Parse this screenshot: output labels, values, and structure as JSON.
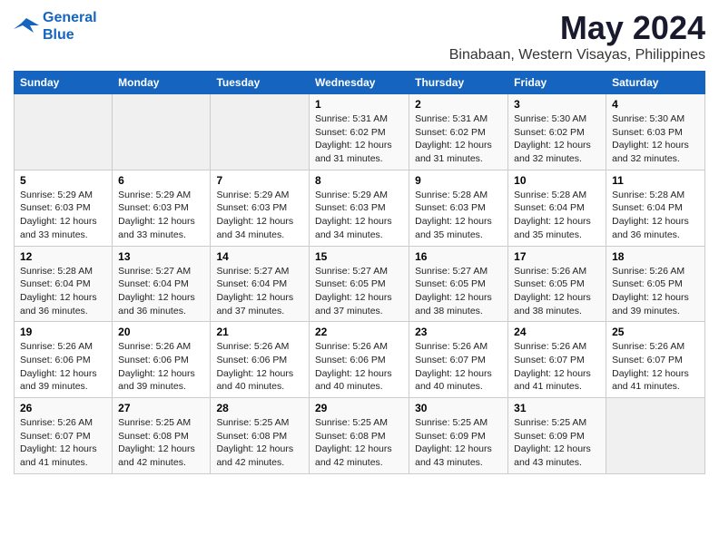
{
  "logo": {
    "line1": "General",
    "line2": "Blue"
  },
  "title": "May 2024",
  "subtitle": "Binabaan, Western Visayas, Philippines",
  "weekdays": [
    "Sunday",
    "Monday",
    "Tuesday",
    "Wednesday",
    "Thursday",
    "Friday",
    "Saturday"
  ],
  "weeks": [
    [
      {
        "day": "",
        "info": ""
      },
      {
        "day": "",
        "info": ""
      },
      {
        "day": "",
        "info": ""
      },
      {
        "day": "1",
        "info": "Sunrise: 5:31 AM\nSunset: 6:02 PM\nDaylight: 12 hours and 31 minutes."
      },
      {
        "day": "2",
        "info": "Sunrise: 5:31 AM\nSunset: 6:02 PM\nDaylight: 12 hours and 31 minutes."
      },
      {
        "day": "3",
        "info": "Sunrise: 5:30 AM\nSunset: 6:02 PM\nDaylight: 12 hours and 32 minutes."
      },
      {
        "day": "4",
        "info": "Sunrise: 5:30 AM\nSunset: 6:03 PM\nDaylight: 12 hours and 32 minutes."
      }
    ],
    [
      {
        "day": "5",
        "info": "Sunrise: 5:29 AM\nSunset: 6:03 PM\nDaylight: 12 hours and 33 minutes."
      },
      {
        "day": "6",
        "info": "Sunrise: 5:29 AM\nSunset: 6:03 PM\nDaylight: 12 hours and 33 minutes."
      },
      {
        "day": "7",
        "info": "Sunrise: 5:29 AM\nSunset: 6:03 PM\nDaylight: 12 hours and 34 minutes."
      },
      {
        "day": "8",
        "info": "Sunrise: 5:29 AM\nSunset: 6:03 PM\nDaylight: 12 hours and 34 minutes."
      },
      {
        "day": "9",
        "info": "Sunrise: 5:28 AM\nSunset: 6:03 PM\nDaylight: 12 hours and 35 minutes."
      },
      {
        "day": "10",
        "info": "Sunrise: 5:28 AM\nSunset: 6:04 PM\nDaylight: 12 hours and 35 minutes."
      },
      {
        "day": "11",
        "info": "Sunrise: 5:28 AM\nSunset: 6:04 PM\nDaylight: 12 hours and 36 minutes."
      }
    ],
    [
      {
        "day": "12",
        "info": "Sunrise: 5:28 AM\nSunset: 6:04 PM\nDaylight: 12 hours and 36 minutes."
      },
      {
        "day": "13",
        "info": "Sunrise: 5:27 AM\nSunset: 6:04 PM\nDaylight: 12 hours and 36 minutes."
      },
      {
        "day": "14",
        "info": "Sunrise: 5:27 AM\nSunset: 6:04 PM\nDaylight: 12 hours and 37 minutes."
      },
      {
        "day": "15",
        "info": "Sunrise: 5:27 AM\nSunset: 6:05 PM\nDaylight: 12 hours and 37 minutes."
      },
      {
        "day": "16",
        "info": "Sunrise: 5:27 AM\nSunset: 6:05 PM\nDaylight: 12 hours and 38 minutes."
      },
      {
        "day": "17",
        "info": "Sunrise: 5:26 AM\nSunset: 6:05 PM\nDaylight: 12 hours and 38 minutes."
      },
      {
        "day": "18",
        "info": "Sunrise: 5:26 AM\nSunset: 6:05 PM\nDaylight: 12 hours and 39 minutes."
      }
    ],
    [
      {
        "day": "19",
        "info": "Sunrise: 5:26 AM\nSunset: 6:06 PM\nDaylight: 12 hours and 39 minutes."
      },
      {
        "day": "20",
        "info": "Sunrise: 5:26 AM\nSunset: 6:06 PM\nDaylight: 12 hours and 39 minutes."
      },
      {
        "day": "21",
        "info": "Sunrise: 5:26 AM\nSunset: 6:06 PM\nDaylight: 12 hours and 40 minutes."
      },
      {
        "day": "22",
        "info": "Sunrise: 5:26 AM\nSunset: 6:06 PM\nDaylight: 12 hours and 40 minutes."
      },
      {
        "day": "23",
        "info": "Sunrise: 5:26 AM\nSunset: 6:07 PM\nDaylight: 12 hours and 40 minutes."
      },
      {
        "day": "24",
        "info": "Sunrise: 5:26 AM\nSunset: 6:07 PM\nDaylight: 12 hours and 41 minutes."
      },
      {
        "day": "25",
        "info": "Sunrise: 5:26 AM\nSunset: 6:07 PM\nDaylight: 12 hours and 41 minutes."
      }
    ],
    [
      {
        "day": "26",
        "info": "Sunrise: 5:26 AM\nSunset: 6:07 PM\nDaylight: 12 hours and 41 minutes."
      },
      {
        "day": "27",
        "info": "Sunrise: 5:25 AM\nSunset: 6:08 PM\nDaylight: 12 hours and 42 minutes."
      },
      {
        "day": "28",
        "info": "Sunrise: 5:25 AM\nSunset: 6:08 PM\nDaylight: 12 hours and 42 minutes."
      },
      {
        "day": "29",
        "info": "Sunrise: 5:25 AM\nSunset: 6:08 PM\nDaylight: 12 hours and 42 minutes."
      },
      {
        "day": "30",
        "info": "Sunrise: 5:25 AM\nSunset: 6:09 PM\nDaylight: 12 hours and 43 minutes."
      },
      {
        "day": "31",
        "info": "Sunrise: 5:25 AM\nSunset: 6:09 PM\nDaylight: 12 hours and 43 minutes."
      },
      {
        "day": "",
        "info": ""
      }
    ]
  ]
}
